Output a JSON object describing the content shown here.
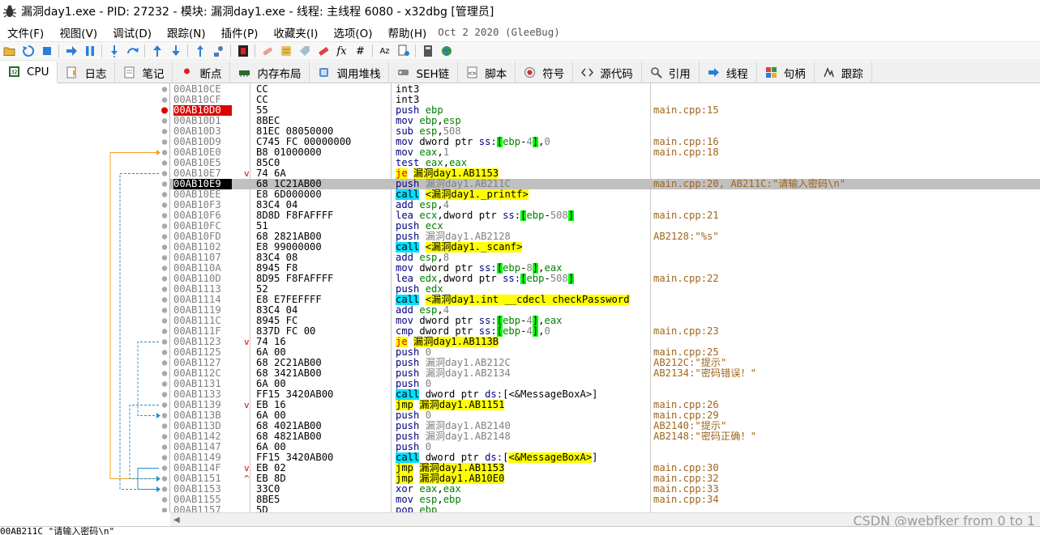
{
  "window": {
    "title": "漏洞day1.exe - PID: 27232 - 模块: 漏洞day1.exe - 线程: 主线程 6080 - x32dbg [管理员]"
  },
  "menubar": {
    "items": [
      "文件(F)",
      "视图(V)",
      "调试(D)",
      "跟踪(N)",
      "插件(P)",
      "收藏夹(I)",
      "选项(O)",
      "帮助(H)"
    ],
    "date": "Oct 2 2020 (GleeBug)"
  },
  "toolbar": {
    "fx": "fx",
    "hash": "#",
    "az": "Az"
  },
  "tabs": [
    {
      "label": "CPU",
      "icon": "cpu-icon"
    },
    {
      "label": "日志",
      "icon": "log-icon"
    },
    {
      "label": "笔记",
      "icon": "notes-icon"
    },
    {
      "label": "断点",
      "icon": "breakpoint-icon"
    },
    {
      "label": "内存布局",
      "icon": "memory-icon"
    },
    {
      "label": "调用堆栈",
      "icon": "callstack-icon"
    },
    {
      "label": "SEH链",
      "icon": "seh-icon"
    },
    {
      "label": "脚本",
      "icon": "script-icon"
    },
    {
      "label": "符号",
      "icon": "symbols-icon"
    },
    {
      "label": "源代码",
      "icon": "source-icon"
    },
    {
      "label": "引用",
      "icon": "references-icon"
    },
    {
      "label": "线程",
      "icon": "threads-icon"
    },
    {
      "label": "句柄",
      "icon": "handles-icon"
    },
    {
      "label": "跟踪",
      "icon": "trace-icon"
    }
  ],
  "colors": {
    "breakpoint": "#e00000",
    "call_highlight": "#00e0ff",
    "jump_highlight": "#ffff00",
    "comment": "#a0651e",
    "selected_row": "#c0c0c0",
    "jump_line_orange": "#f0a020",
    "jump_line_blue": "#2090d0"
  },
  "disasm": [
    {
      "addr": "00AB10CE",
      "bytes": "CC",
      "instr": "int3",
      "kind": "plain",
      "comment": ""
    },
    {
      "addr": "00AB10CF",
      "bytes": "CC",
      "instr": "int3",
      "kind": "plain",
      "comment": ""
    },
    {
      "addr": "00AB10D0",
      "bytes": "55",
      "instr": "push ebp",
      "kind": "push",
      "comment": "main.cpp:15",
      "bp": true
    },
    {
      "addr": "00AB10D1",
      "bytes": "8BEC",
      "instr": "mov ebp,esp",
      "kind": "plain",
      "comment": ""
    },
    {
      "addr": "00AB10D3",
      "bytes": "81EC 08050000",
      "instr": "sub esp,508",
      "kind": "plain",
      "comment": ""
    },
    {
      "addr": "00AB10D9",
      "bytes": "C745 FC 00000000",
      "instr": "mov dword ptr ss:[ebp-4],0",
      "kind": "plain",
      "comment": "main.cpp:16"
    },
    {
      "addr": "00AB10E0",
      "bytes": "B8 01000000",
      "instr": "mov eax,1",
      "kind": "plain",
      "comment": "main.cpp:18"
    },
    {
      "addr": "00AB10E5",
      "bytes": "85C0",
      "instr": "test eax,eax",
      "kind": "plain",
      "comment": ""
    },
    {
      "addr": "00AB10E7",
      "bytes": "74 6A",
      "instr": "je 漏洞day1.AB1153",
      "kind": "jcc",
      "comment": "",
      "marker": "v"
    },
    {
      "addr": "00AB10E9",
      "bytes": "68 1C21AB00",
      "instr": "push 漏洞day1.AB211C",
      "kind": "push",
      "comment": "main.cpp:20, AB211C:\"请输入密码\\n\"",
      "selected": true,
      "cur": true
    },
    {
      "addr": "00AB10EE",
      "bytes": "E8 6D000000",
      "instr": "call <漏洞day1._printf>",
      "kind": "call",
      "comment": ""
    },
    {
      "addr": "00AB10F3",
      "bytes": "83C4 04",
      "instr": "add esp,4",
      "kind": "plain",
      "comment": ""
    },
    {
      "addr": "00AB10F6",
      "bytes": "8D8D F8FAFFFF",
      "instr": "lea ecx,dword ptr ss:[ebp-508]",
      "kind": "plain",
      "comment": "main.cpp:21"
    },
    {
      "addr": "00AB10FC",
      "bytes": "51",
      "instr": "push ecx",
      "kind": "push",
      "comment": ""
    },
    {
      "addr": "00AB10FD",
      "bytes": "68 2821AB00",
      "instr": "push 漏洞day1.AB2128",
      "kind": "push",
      "comment": "AB2128:\"%s\""
    },
    {
      "addr": "00AB1102",
      "bytes": "E8 99000000",
      "instr": "call <漏洞day1._scanf>",
      "kind": "call",
      "comment": ""
    },
    {
      "addr": "00AB1107",
      "bytes": "83C4 08",
      "instr": "add esp,8",
      "kind": "plain",
      "comment": ""
    },
    {
      "addr": "00AB110A",
      "bytes": "8945 F8",
      "instr": "mov dword ptr ss:[ebp-8],eax",
      "kind": "plain",
      "comment": ""
    },
    {
      "addr": "00AB110D",
      "bytes": "8D95 F8FAFFFF",
      "instr": "lea edx,dword ptr ss:[ebp-508]",
      "kind": "plain",
      "comment": "main.cpp:22"
    },
    {
      "addr": "00AB1113",
      "bytes": "52",
      "instr": "push edx",
      "kind": "push",
      "comment": ""
    },
    {
      "addr": "00AB1114",
      "bytes": "E8 E7FEFFFF",
      "instr": "call <漏洞day1.int __cdecl checkPassword",
      "kind": "call",
      "comment": ""
    },
    {
      "addr": "00AB1119",
      "bytes": "83C4 04",
      "instr": "add esp,4",
      "kind": "plain",
      "comment": ""
    },
    {
      "addr": "00AB111C",
      "bytes": "8945 FC",
      "instr": "mov dword ptr ss:[ebp-4],eax",
      "kind": "plain",
      "comment": ""
    },
    {
      "addr": "00AB111F",
      "bytes": "837D FC 00",
      "instr": "cmp dword ptr ss:[ebp-4],0",
      "kind": "plain",
      "comment": "main.cpp:23"
    },
    {
      "addr": "00AB1123",
      "bytes": "74 16",
      "instr": "je 漏洞day1.AB113B",
      "kind": "jcc",
      "comment": "",
      "marker": "v"
    },
    {
      "addr": "00AB1125",
      "bytes": "6A 00",
      "instr": "push 0",
      "kind": "push",
      "comment": "main.cpp:25"
    },
    {
      "addr": "00AB1127",
      "bytes": "68 2C21AB00",
      "instr": "push 漏洞day1.AB212C",
      "kind": "push",
      "comment": "AB212C:\"提示\""
    },
    {
      "addr": "00AB112C",
      "bytes": "68 3421AB00",
      "instr": "push 漏洞day1.AB2134",
      "kind": "push",
      "comment": "AB2134:\"密码错误！\""
    },
    {
      "addr": "00AB1131",
      "bytes": "6A 00",
      "instr": "push 0",
      "kind": "push",
      "comment": ""
    },
    {
      "addr": "00AB1133",
      "bytes": "FF15 3420AB00",
      "instr": "call dword ptr ds:[<&MessageBoxA>]",
      "kind": "callind",
      "comment": ""
    },
    {
      "addr": "00AB1139",
      "bytes": "EB 16",
      "instr": "jmp 漏洞day1.AB1151",
      "kind": "jmp",
      "comment": "main.cpp:26",
      "marker": "v"
    },
    {
      "addr": "00AB113B",
      "bytes": "6A 00",
      "instr": "push 0",
      "kind": "push",
      "comment": "main.cpp:29"
    },
    {
      "addr": "00AB113D",
      "bytes": "68 4021AB00",
      "instr": "push 漏洞day1.AB2140",
      "kind": "push",
      "comment": "AB2140:\"提示\""
    },
    {
      "addr": "00AB1142",
      "bytes": "68 4821AB00",
      "instr": "push 漏洞day1.AB2148",
      "kind": "push",
      "comment": "AB2148:\"密码正确！\""
    },
    {
      "addr": "00AB1147",
      "bytes": "6A 00",
      "instr": "push 0",
      "kind": "push",
      "comment": ""
    },
    {
      "addr": "00AB1149",
      "bytes": "FF15 3420AB00",
      "instr": "call dword ptr ds:[<&MessageBoxA>]",
      "kind": "callind2",
      "comment": ""
    },
    {
      "addr": "00AB114F",
      "bytes": "EB 02",
      "instr": "jmp 漏洞day1.AB1153",
      "kind": "jmp",
      "comment": "main.cpp:30",
      "marker": "v"
    },
    {
      "addr": "00AB1151",
      "bytes": "EB 8D",
      "instr": "jmp 漏洞day1.AB10E0",
      "kind": "jmp",
      "comment": "main.cpp:32",
      "marker": "^"
    },
    {
      "addr": "00AB1153",
      "bytes": "33C0",
      "instr": "xor eax,eax",
      "kind": "plain",
      "comment": "main.cpp:33"
    },
    {
      "addr": "00AB1155",
      "bytes": "8BE5",
      "instr": "mov esp,ebp",
      "kind": "plain",
      "comment": "main.cpp:34"
    },
    {
      "addr": "00AB1157",
      "bytes": "5D",
      "instr": "pop ebp",
      "kind": "plain",
      "comment": ""
    }
  ],
  "status": {
    "text": "00AB211C \"请输入密码\\n\""
  },
  "watermark": "CSDN @webfker from 0 to 1"
}
